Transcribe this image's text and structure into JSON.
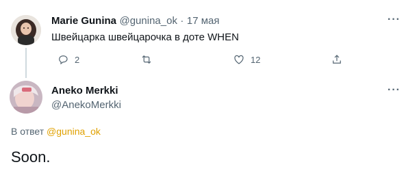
{
  "reply_tweet": {
    "author_name": "Marie Gunina",
    "handle": "@gunina_ok",
    "separator": "·",
    "date": "17 мая",
    "text": "Швейцарка швейцарочка в доте WHEN",
    "more_icon": "more-dots-icon",
    "actions": {
      "reply_count": "2",
      "retweet_count": "",
      "like_count": "12",
      "share_count": ""
    }
  },
  "main_tweet": {
    "author_name": "Aneko Merkki",
    "handle": "@AnekoMerkki",
    "more_icon": "more-dots-icon",
    "reply_to_prefix": "В ответ",
    "reply_to_handle": "@gunina_ok",
    "text": "Soon."
  },
  "colors": {
    "text": "#0f1419",
    "muted": "#536471",
    "reply_link": "#e0a100",
    "thread_line": "#cfd9de"
  }
}
